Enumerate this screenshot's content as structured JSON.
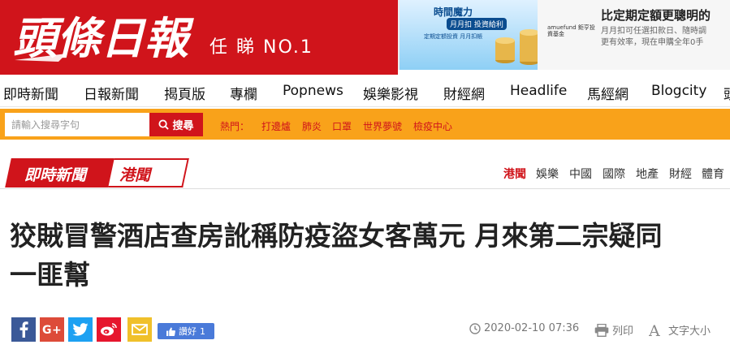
{
  "brand": {
    "logo_text": "頭條日報",
    "slogan": "任 睇 NO.1"
  },
  "ad": {
    "left_title": "時間魔力",
    "left_sub": "月月扣   投資給利",
    "left_note": "定期定額投資    月月扣帳",
    "right_logo": "amuefund 鉅亨投資基金",
    "right_title": "比定期定額更聰明的",
    "right_sub1": "月月扣可任選扣款日、隨時調",
    "right_sub2": "更有效率，現在申購全年0手"
  },
  "nav": [
    "即時新聞",
    "日報新聞",
    "揭頁版",
    "專欄",
    "Popnews",
    "娛樂影視",
    "財經網",
    "Headlife",
    "馬經網",
    "Blogcity",
    "頭"
  ],
  "search": {
    "placeholder": "請輸入搜尋字句",
    "button": "搜尋",
    "hot_label": "熱門：",
    "hot_items": [
      "打邊爐",
      "肺炎",
      "口罩",
      "世界夢號",
      "檢疫中心"
    ]
  },
  "section": {
    "primary": "即時新聞",
    "secondary": "港聞",
    "categories": [
      "港聞",
      "娛樂",
      "中國",
      "國際",
      "地產",
      "財經",
      "體育"
    ]
  },
  "article": {
    "title_line1": "狡賊冒警酒店查房訛稱防疫盜女客萬元 月來第二宗疑同",
    "title_line2": "一匪幫",
    "like_label": "讚好",
    "like_count": "1",
    "datetime": "2020-02-10 07:36",
    "print_label": "列印",
    "font_size_label": "文字大小"
  },
  "colors": {
    "brand_red": "#d0141b",
    "search_orange": "#f9a21a",
    "facebook": "#3b5998",
    "google": "#dd4b39",
    "twitter": "#1da1f2",
    "weibo": "#e6162d",
    "email": "#f0c02a"
  }
}
